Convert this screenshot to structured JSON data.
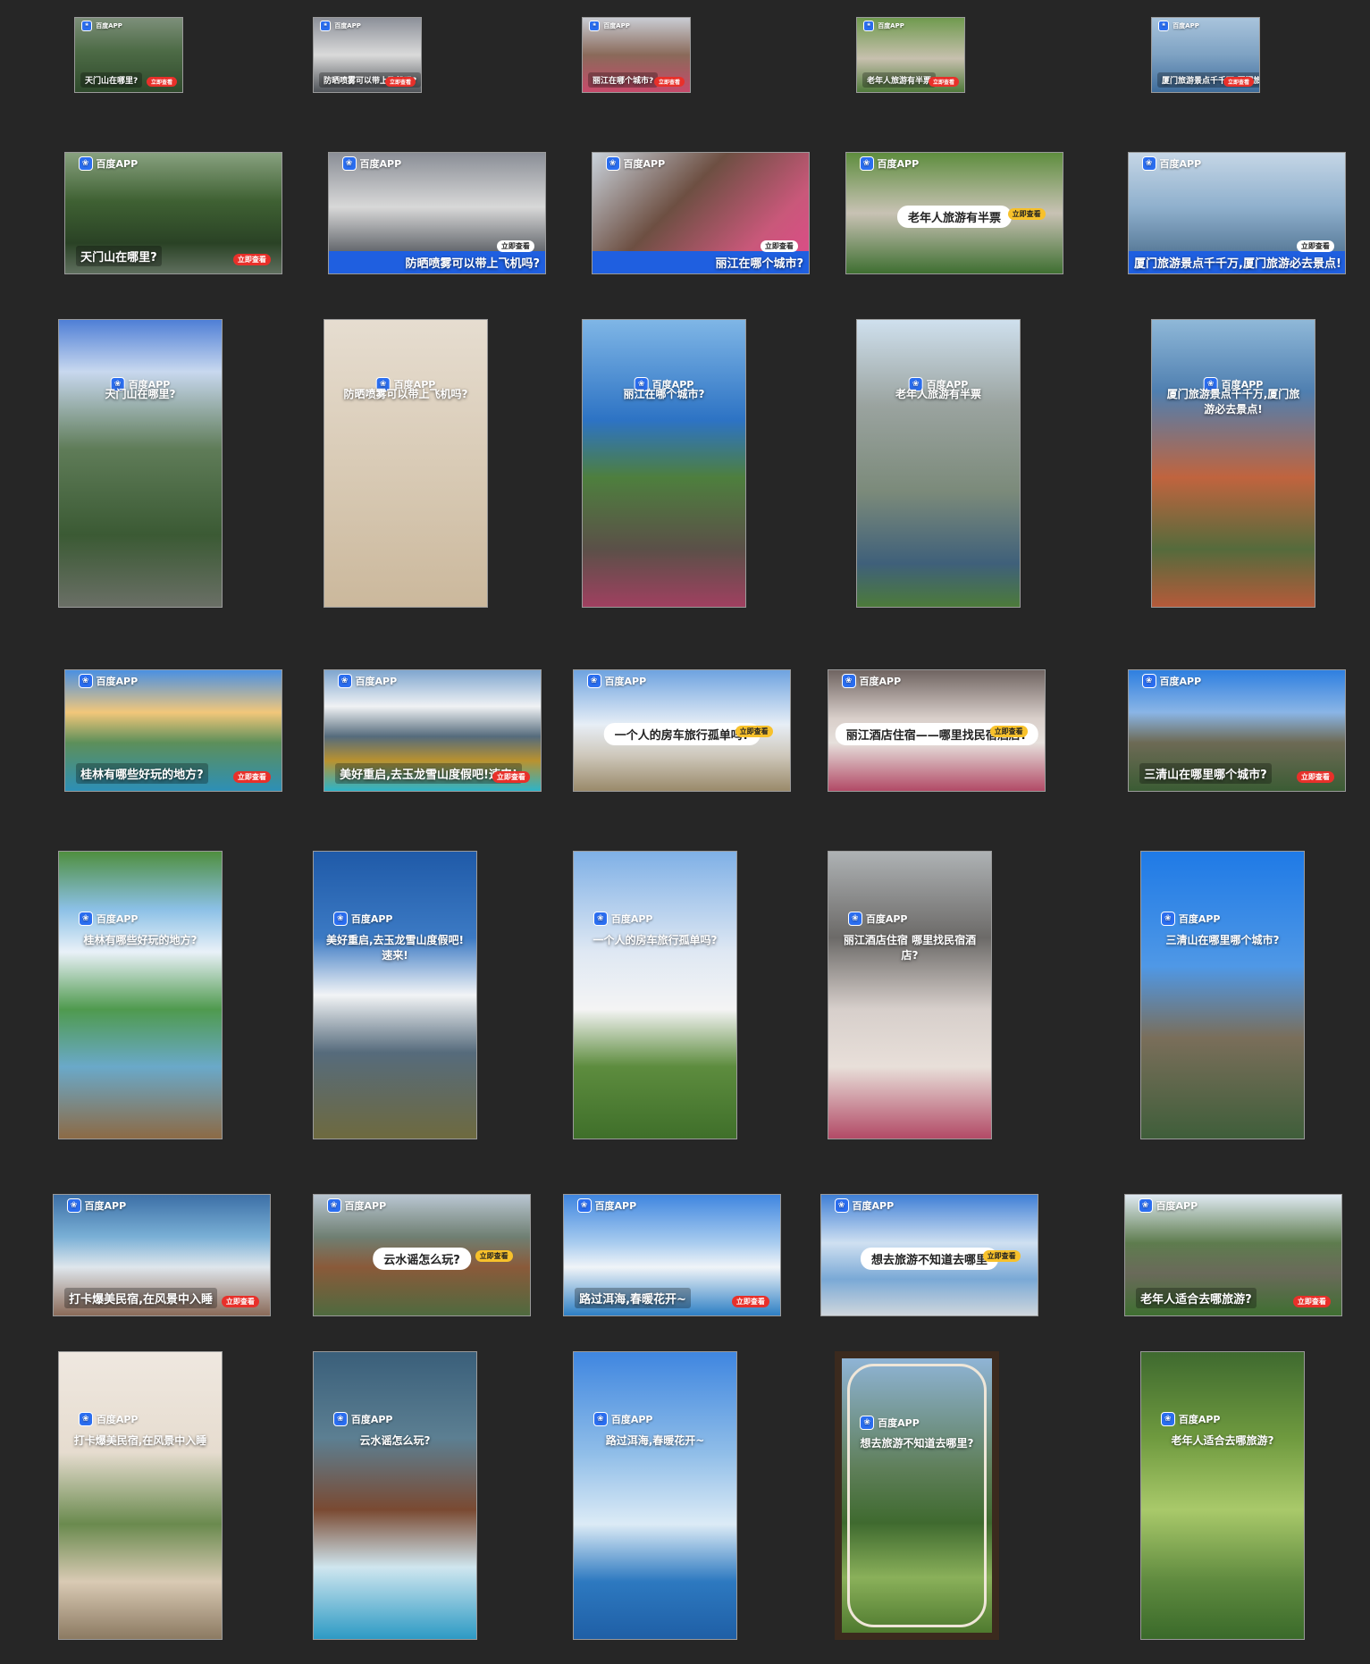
{
  "colors": {
    "background": "#262626",
    "brand_blue": "#2b6ef0",
    "cta_red": "#e8302a",
    "cta_yellow": "#f7c12b"
  },
  "ads": [
    {
      "size": "small",
      "brand": "百度APP",
      "caption": "天门山在哪里?",
      "cta": "立即查看",
      "bg": "linear-gradient(180deg,#7d8f7a 0%,#4d6b46 45%,#2f4a2c 100%)"
    },
    {
      "size": "small",
      "brand": "百度APP",
      "caption": "防晒喷雾可以带上飞机吗?",
      "cta": "立即查看",
      "bg": "linear-gradient(180deg,#8c9099 0%,#dadada 50%,#4f5358 100%)"
    },
    {
      "size": "small",
      "brand": "百度APP",
      "caption": "丽江在哪个城市?",
      "cta": "立即查看",
      "bg": "linear-gradient(180deg,#c9ccd3 0%,#8a6a5a 50%,#c74a6a 100%)"
    },
    {
      "size": "small",
      "brand": "百度APP",
      "caption": "老年人旅游有半票",
      "cta": "立即查看",
      "bg": "linear-gradient(180deg,#6f9a4e 0%,#c7c0ae 55%,#4f7a3a 100%)"
    },
    {
      "size": "small",
      "brand": "百度APP",
      "caption": "厦门旅游景点千千万,厦门旅游必去景点!",
      "cta": "立即查看",
      "bg": "linear-gradient(180deg,#a9c4dc 0%,#7ea2c3 50%,#3f6d9c 100%)"
    },
    {
      "size": "land",
      "style": "plain",
      "brand": "百度APP",
      "caption": "天门山在哪里?",
      "cta": "立即查看",
      "bg": "linear-gradient(180deg,#88a17f 0%,#3f6133 40%,#2a4225 75%,#5f6f5e 100%)"
    },
    {
      "size": "land",
      "style": "bar",
      "brand": "百度APP",
      "caption": "防晒喷雾可以带上飞机吗?",
      "cta": "立即查看",
      "bg": "linear-gradient(180deg,#8a8e96 0%,#d8d8d8 45%,#5a5e64 85%,#1f5fe0 100%)"
    },
    {
      "size": "land",
      "style": "bar",
      "brand": "百度APP",
      "caption": "丽江在哪个城市?",
      "cta": "立即查看",
      "bg": "linear-gradient(135deg,#c9d2db 0%,#6d4f42 40%,#c9587a 75%,#e04a8a 100%)"
    },
    {
      "size": "land",
      "style": "pill",
      "brand": "百度APP",
      "caption": "老年人旅游有半票",
      "cta": "立即查看",
      "bg": "linear-gradient(180deg,#5e8d3e 0%,#c8c2b4 50%,#3f6f31 100%)"
    },
    {
      "size": "land",
      "style": "bar",
      "brand": "百度APP",
      "caption": "厦门旅游景点千千万,厦门旅游必去景点!",
      "cta": "立即查看",
      "bg": "linear-gradient(180deg,#c5d6e6 0%,#8fb0cd 45%,#5d7f9d 80%,#1f5fe0 100%)"
    },
    {
      "size": "port",
      "brand": "百度APP",
      "caption": "天门山在哪里?",
      "bg": "linear-gradient(180deg,#4f7fd6 0%,#c8d8ef 18%,#5f7c58 45%,#3b5a34 75%,#6a6f66 100%)"
    },
    {
      "size": "port",
      "brand": "百度APP",
      "caption": "防晒喷雾可以带上飞机吗?",
      "bg": "linear-gradient(180deg,#e6ddd0 0%,#d9cbb6 50%,#cbb89c 100%)"
    },
    {
      "size": "port",
      "brand": "百度APP",
      "caption": "丽江在哪个城市?",
      "bg": "linear-gradient(180deg,#7fb6e6 0%,#2d73c4 35%,#4e7f3e 55%,#5b5048 80%,#a04060 100%)"
    },
    {
      "size": "port",
      "brand": "百度APP",
      "caption": "老年人旅游有半票",
      "bg": "linear-gradient(180deg,#cfe0ee 0%,#9aa39f 30%,#7b8a7a 60%,#3f607a 85%,#4c7a3a 100%)"
    },
    {
      "size": "port",
      "brand": "百度APP",
      "caption": "厦门旅游景点千千万,厦门旅游必去景点!",
      "bg": "linear-gradient(180deg,#8fb8d8 0%,#4f7fb0 25%,#c0643e 55%,#556b3c 80%,#b55a3a 100%)"
    },
    {
      "size": "land",
      "style": "plain",
      "brand": "百度APP",
      "caption": "桂林有哪些好玩的地方?",
      "cta": "立即查看",
      "bg": "linear-gradient(180deg,#4a90e2 0%,#f2c77a 35%,#5d8f5a 60%,#2d8fb6 100%)"
    },
    {
      "size": "land",
      "style": "plain",
      "brand": "百度APP",
      "caption": "美好重启,去玉龙雪山度假吧!速来!",
      "cta": "立即查看",
      "bg": "linear-gradient(180deg,#7fa6cf 0%,#f0f2f4 30%,#556b7c 55%,#b9922f 75%,#2db3c8 100%)"
    },
    {
      "size": "land",
      "style": "pill",
      "brand": "百度APP",
      "caption": "一个人的房车旅行孤单吗?",
      "cta": "立即查看",
      "bg": "linear-gradient(180deg,#6ea3e0 0%,#e7eef6 45%,#cfc9bd 70%,#9a8a6a 100%)"
    },
    {
      "size": "land",
      "style": "pill",
      "brand": "百度APP",
      "caption": "丽江酒店住宿——哪里找民宿酒店?",
      "cta": "立即查看",
      "bg": "linear-gradient(180deg,#6f6461 0%,#d9cfca 40%,#e6e0dc 60%,#b24a66 100%)"
    },
    {
      "size": "land",
      "style": "plain",
      "brand": "百度APP",
      "caption": "三清山在哪里哪个城市?",
      "cta": "立即查看",
      "bg": "linear-gradient(180deg,#2e7fe0 0%,#8ab5e6 35%,#6d6a55 60%,#3b5c34 100%)"
    },
    {
      "size": "port",
      "style": "top",
      "brand": "百度APP",
      "caption": "桂林有哪些好玩的地方?",
      "bg": "linear-gradient(180deg,#4f8f3f 0%,#8bc0e6 20%,#e9f1f8 35%,#4f9a4e 55%,#6aa9c9 75%,#8c6a45 100%)"
    },
    {
      "size": "port",
      "style": "top",
      "brand": "百度APP",
      "caption": "美好重启,去玉龙雪山度假吧!速来!",
      "bg": "linear-gradient(180deg,#1f5aa8 0%,#3c7ac4 30%,#f2f4f6 50%,#566b7c 70%,#6e6a3f 100%)"
    },
    {
      "size": "port",
      "style": "top",
      "brand": "百度APP",
      "caption": "一个人的房车旅行孤单吗?",
      "bg": "linear-gradient(180deg,#7fb0e6 0%,#dfe8f3 35%,#f4f4f4 55%,#5d8c3e 75%,#3f6f2a 100%)"
    },
    {
      "size": "port",
      "style": "top",
      "brand": "百度APP",
      "caption": "丽江酒店住宿 哪里找民宿酒店?",
      "bg": "linear-gradient(180deg,#aeb2b4 0%,#6c6a68 30%,#d7cfcb 55%,#e8dfd9 75%,#b24a66 100%)"
    },
    {
      "size": "port",
      "style": "top",
      "brand": "百度APP",
      "caption": "三清山在哪里哪个城市?",
      "bg": "linear-gradient(180deg,#1f7ae6 0%,#4f98e6 40%,#7a6e5a 65%,#3f5e3a 100%)"
    },
    {
      "size": "land",
      "style": "plain",
      "brand": "百度APP",
      "caption": "打卡爆美民宿,在风景中入睡",
      "cta": "立即查看",
      "bg": "linear-gradient(180deg,#3c6fa6 0%,#7ab0d6 35%,#dfe6ec 60%,#8a6a58 100%)"
    },
    {
      "size": "land",
      "style": "pill",
      "brand": "百度APP",
      "caption": "云水谣怎么玩?",
      "cta": "立即查看",
      "bg": "linear-gradient(180deg,#b9c6d2 0%,#6f7f72 35%,#8a5a3a 60%,#4f6a3f 100%)"
    },
    {
      "size": "land",
      "style": "plain",
      "brand": "百度APP",
      "caption": "路过洱海,春暖花开~",
      "cta": "立即查看",
      "bg": "linear-gradient(180deg,#3f86e0 0%,#a9ccef 40%,#f0f4f8 60%,#2d7fc4 100%)"
    },
    {
      "size": "land",
      "style": "pill",
      "brand": "百度APP",
      "caption": "想去旅游不知道去哪里",
      "cta": "立即查看",
      "bg": "linear-gradient(180deg,#3f7fd6 0%,#cfe0f1 40%,#7aa9d6 70%,#cfd6dc 100%)"
    },
    {
      "size": "land",
      "style": "plain",
      "brand": "百度APP",
      "caption": "老年人适合去哪旅游?",
      "cta": "立即查看",
      "bg": "linear-gradient(180deg,#dfe9f2 0%,#5e7c4e 40%,#6a6a5a 65%,#3f6f31 100%)"
    },
    {
      "size": "port",
      "style": "top",
      "brand": "百度APP",
      "caption": "打卡爆美民宿,在风景中入睡",
      "bg": "linear-gradient(180deg,#efe8e0 0%,#e6dccf 35%,#6a8a4e 60%,#d9cab4 80%,#8c7a62 100%)"
    },
    {
      "size": "port",
      "style": "top",
      "brand": "百度APP",
      "caption": "云水谣怎么玩?",
      "bg": "linear-gradient(180deg,#3a5f7a 0%,#5c7f92 30%,#7a4a32 55%,#cfe6ef 75%,#2d9ac4 100%)"
    },
    {
      "size": "port",
      "style": "top",
      "brand": "百度APP",
      "caption": "路过洱海,春暖花开~",
      "bg": "linear-gradient(180deg,#3f86e0 0%,#8fbde8 35%,#dcebf6 60%,#2d79c0 80%,#1f5fa6 100%)"
    },
    {
      "size": "port",
      "style": "top",
      "frame": "window",
      "brand": "百度APP",
      "caption": "想去旅游不知道去哪里?",
      "bg": "linear-gradient(180deg,#8fb4d6 0%,#5f7f5a 40%,#3f6a2f 60%,#8ab05a 80%,#4f7a2f 100%)"
    },
    {
      "size": "port",
      "style": "top",
      "brand": "百度APP",
      "caption": "老年人适合去哪旅游?",
      "bg": "linear-gradient(180deg,#3f6a2f 0%,#6f9a3f 30%,#a9c96a 55%,#5f8a3f 80%,#3a6a2a 100%)"
    }
  ]
}
